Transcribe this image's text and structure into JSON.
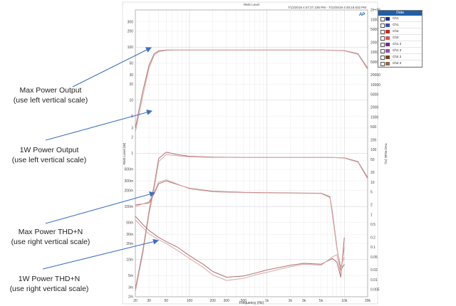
{
  "annotations": [
    {
      "line1": "Max Power Output",
      "line2": "(use left vertical scale)"
    },
    {
      "line1": "1W Power Output",
      "line2": "(use left vertical scale)"
    },
    {
      "line1": "Max Power THD+N",
      "line2": "(use right vertical scale)"
    },
    {
      "line1": "1W Power THD+N",
      "line2": "(use right vertical scale)"
    }
  ],
  "colors": {
    "curve": "#b26f6f",
    "curve_alt": "#d7a9a9",
    "arrow": "#3f6fc2",
    "legend_header": "#1f5fa8"
  },
  "chart_data": {
    "type": "line",
    "title": "RMS Level",
    "timestamp": "7/12/2019 4:47:27.236 PM - 7/12/2019 4:48:18.632 PM",
    "logo": "AP",
    "xlabel": "Frequency (Hz)",
    "ylabel": "RMS Level (W)",
    "y2label": "THD Ratio (%)",
    "x_scale": "log",
    "y_scale": "log",
    "xlim": [
      20,
      20000
    ],
    "ylim": [
      0.002,
      500
    ],
    "y2lim": [
      0.003,
      2000000
    ],
    "grid": true,
    "x_ticks": [
      {
        "v": 20,
        "label": "20"
      },
      {
        "v": 30,
        "label": "30"
      },
      {
        "v": 50,
        "label": "50"
      },
      {
        "v": 100,
        "label": "100"
      },
      {
        "v": 200,
        "label": "200"
      },
      {
        "v": 300,
        "label": "300"
      },
      {
        "v": 500,
        "label": "500"
      },
      {
        "v": 1000,
        "label": "1k"
      },
      {
        "v": 2000,
        "label": "2k"
      },
      {
        "v": 3000,
        "label": "3k"
      },
      {
        "v": 5000,
        "label": "5k"
      },
      {
        "v": 10000,
        "label": "10k"
      },
      {
        "v": 20000,
        "label": "20k"
      }
    ],
    "y_ticks": [
      {
        "v": 300,
        "label": "300"
      },
      {
        "v": 200,
        "label": "200"
      },
      {
        "v": 100,
        "label": "100"
      },
      {
        "v": 50,
        "label": "50"
      },
      {
        "v": 30,
        "label": "30"
      },
      {
        "v": 20,
        "label": "20"
      },
      {
        "v": 10,
        "label": "10"
      },
      {
        "v": 5,
        "label": "5"
      },
      {
        "v": 3,
        "label": "3"
      },
      {
        "v": 2,
        "label": "2"
      },
      {
        "v": 1,
        "label": "1"
      },
      {
        "v": 0.5,
        "label": "500m"
      },
      {
        "v": 0.3,
        "label": "300m"
      },
      {
        "v": 0.2,
        "label": "200m"
      },
      {
        "v": 0.1,
        "label": "100m"
      },
      {
        "v": 0.05,
        "label": "50m"
      },
      {
        "v": 0.03,
        "label": "30m"
      },
      {
        "v": 0.02,
        "label": "20m"
      },
      {
        "v": 0.01,
        "label": "10m"
      },
      {
        "v": 0.005,
        "label": "5m"
      },
      {
        "v": 0.003,
        "label": "3m"
      },
      {
        "v": 0.002,
        "label": "2m"
      },
      {
        "v": 0.001,
        "label": "1m"
      },
      {
        "v": 0.0005,
        "label": "500u"
      },
      {
        "v": 0.0003,
        "label": "300u"
      },
      {
        "v": 0.0002,
        "label": "200u"
      },
      {
        "v": 0.0001,
        "label": "100u"
      },
      {
        "v": 5e-05,
        "label": "50u"
      },
      {
        "v": 3e-05,
        "label": "30u"
      },
      {
        "v": 2e-05,
        "label": "20u"
      },
      {
        "v": 1e-05,
        "label": "10u"
      },
      {
        "v": 5e-06,
        "label": "5u"
      },
      {
        "v": 3e-06,
        "label": "3u"
      },
      {
        "v": 2e-06,
        "label": "2u"
      }
    ],
    "y2_ticks": [
      {
        "v": 10000000,
        "label": "1e+07"
      },
      {
        "v": 5000000,
        "label": "5e+06"
      },
      {
        "v": 2000000,
        "label": "2e+06"
      },
      {
        "v": 1000000,
        "label": "1000000"
      },
      {
        "v": 500000,
        "label": "500000"
      },
      {
        "v": 200000,
        "label": "200000"
      },
      {
        "v": 100000,
        "label": "100000"
      },
      {
        "v": 50000,
        "label": "50000"
      },
      {
        "v": 20000,
        "label": "20000"
      },
      {
        "v": 10000,
        "label": "10000"
      },
      {
        "v": 5000,
        "label": "5000"
      },
      {
        "v": 2000,
        "label": "2000"
      },
      {
        "v": 1000,
        "label": "1000"
      },
      {
        "v": 500,
        "label": "500"
      },
      {
        "v": 200,
        "label": "200"
      },
      {
        "v": 100,
        "label": "100"
      },
      {
        "v": 50,
        "label": "50"
      },
      {
        "v": 20,
        "label": "20"
      },
      {
        "v": 10,
        "label": "10"
      },
      {
        "v": 5,
        "label": "5"
      },
      {
        "v": 2,
        "label": "2"
      },
      {
        "v": 1,
        "label": "1"
      },
      {
        "v": 0.5,
        "label": "0.5"
      },
      {
        "v": 0.2,
        "label": "0.2"
      },
      {
        "v": 0.1,
        "label": "0.1"
      },
      {
        "v": 0.05,
        "label": "0.05"
      },
      {
        "v": 0.02,
        "label": "0.02"
      },
      {
        "v": 0.01,
        "label": "0.01"
      },
      {
        "v": 0.005,
        "label": "0.005"
      }
    ],
    "series": [
      {
        "axis": "left",
        "x": [
          20,
          25,
          30,
          35,
          40,
          50,
          100,
          200,
          1000,
          5000,
          10000,
          15000,
          20000
        ],
        "y": [
          3,
          15,
          45,
          75,
          85,
          88,
          88,
          88,
          88,
          88,
          86,
          75,
          40
        ]
      },
      {
        "axis": "left",
        "x": [
          20,
          25,
          30,
          35,
          40,
          50,
          100,
          200,
          1000,
          5000,
          10000,
          15000,
          20000
        ],
        "y": [
          2.5,
          12,
          40,
          70,
          82,
          87,
          88,
          88,
          88,
          88,
          85,
          73,
          38
        ]
      },
      {
        "axis": "left",
        "x": [
          20,
          25,
          30,
          35,
          40,
          50,
          70,
          100,
          200,
          500,
          1000,
          3000,
          7000,
          10000,
          15000,
          20000
        ],
        "y": [
          0.0028,
          0.015,
          0.08,
          0.25,
          0.8,
          1.05,
          0.95,
          0.88,
          0.85,
          0.84,
          0.84,
          0.84,
          0.84,
          0.82,
          0.7,
          0.35
        ]
      },
      {
        "axis": "left",
        "x": [
          20,
          25,
          30,
          35,
          40,
          50,
          70,
          100,
          200,
          500,
          1000,
          3000,
          7000,
          10000,
          15000,
          20000
        ],
        "y": [
          0.0025,
          0.013,
          0.07,
          0.22,
          0.7,
          0.95,
          0.9,
          0.86,
          0.84,
          0.84,
          0.84,
          0.84,
          0.84,
          0.81,
          0.68,
          0.33
        ]
      },
      {
        "axis": "right",
        "x": [
          20,
          30,
          35,
          40,
          50,
          100,
          200,
          500,
          1000,
          2000,
          5000,
          6500,
          7000,
          8000,
          9000,
          10000
        ],
        "y": [
          2,
          2.3,
          4.5,
          9,
          11,
          6.5,
          5.3,
          4.9,
          4.8,
          4.7,
          4.6,
          3.6,
          1.2,
          0.1,
          0.02,
          0.03
        ]
      },
      {
        "axis": "right",
        "x": [
          20,
          30,
          35,
          40,
          50,
          100,
          200,
          500,
          1000,
          2000,
          5000,
          6500,
          7000,
          8000,
          9000,
          10000
        ],
        "y": [
          1.8,
          2.5,
          5,
          10,
          12,
          6.3,
          5.1,
          4.8,
          4.7,
          4.6,
          4.5,
          3.4,
          1.0,
          0.09,
          0.025,
          0.05
        ]
      },
      {
        "axis": "right",
        "x": [
          20,
          25,
          30,
          40,
          50,
          70,
          100,
          150,
          200,
          300,
          500,
          700,
          1000,
          2000,
          3000,
          5000,
          7000,
          8000,
          9000,
          10000
        ],
        "y": [
          0.9,
          0.5,
          0.33,
          0.2,
          0.15,
          0.1,
          0.055,
          0.03,
          0.018,
          0.012,
          0.013,
          0.016,
          0.02,
          0.028,
          0.032,
          0.03,
          0.045,
          0.035,
          0.012,
          0.2
        ]
      },
      {
        "axis": "right",
        "x": [
          20,
          25,
          30,
          40,
          50,
          70,
          100,
          150,
          200,
          300,
          500,
          700,
          1000,
          2000,
          3000,
          5000,
          7000,
          8000,
          9000,
          10000
        ],
        "y": [
          0.7,
          0.4,
          0.26,
          0.17,
          0.13,
          0.08,
          0.045,
          0.024,
          0.014,
          0.0095,
          0.011,
          0.014,
          0.017,
          0.025,
          0.03,
          0.028,
          0.05,
          0.06,
          0.015,
          0.1
        ]
      }
    ]
  },
  "legend": {
    "title": "Data",
    "items": [
      {
        "label": "Ch1",
        "color": "#1b2f8a",
        "checked": true
      },
      {
        "label": "Ch1",
        "color": "#3b4fa8",
        "checked": true
      },
      {
        "label": "Ch2",
        "color": "#c42b2b",
        "checked": true
      },
      {
        "label": "Ch2",
        "color": "#d95555",
        "checked": true
      },
      {
        "label": "Ch1 2",
        "color": "#7a2b8a",
        "checked": true
      },
      {
        "label": "Ch1 2",
        "color": "#9a4fa8",
        "checked": true
      },
      {
        "label": "Ch2 2",
        "color": "#6a4a1e",
        "checked": true
      },
      {
        "label": "Ch2 2",
        "color": "#8a6a3e",
        "checked": true
      }
    ]
  }
}
